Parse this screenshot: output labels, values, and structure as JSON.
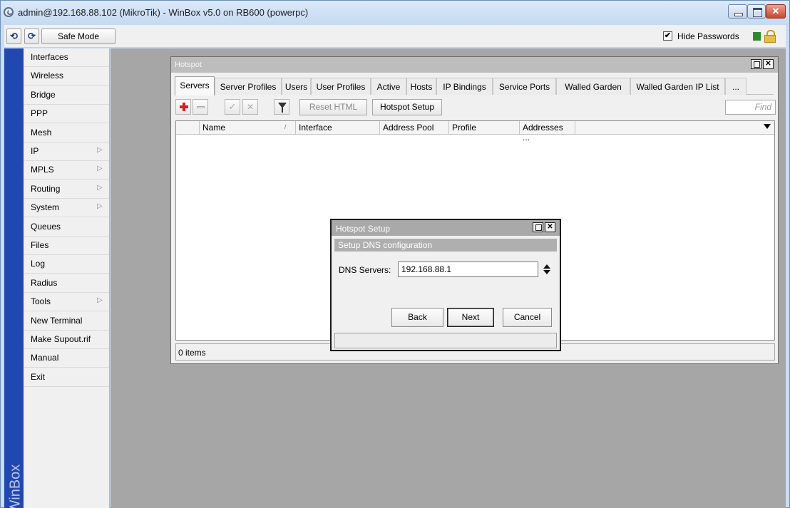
{
  "window": {
    "title": "admin@192.168.88.102 (MikroTik) - WinBox v5.0 on RB600 (powerpc)"
  },
  "toolbar": {
    "undo_icon": "undo-icon",
    "redo_icon": "redo-icon",
    "safe_mode_label": "Safe Mode",
    "hide_passwords_label": "Hide Passwords",
    "hide_passwords_checked": true,
    "hide_passwords_mark": "✔"
  },
  "brand": {
    "vertical_text": "S WinBox"
  },
  "sidebar": {
    "items": [
      {
        "label": "Interfaces",
        "submenu": false
      },
      {
        "label": "Wireless",
        "submenu": false
      },
      {
        "label": "Bridge",
        "submenu": false
      },
      {
        "label": "PPP",
        "submenu": false
      },
      {
        "label": "Mesh",
        "submenu": false
      },
      {
        "label": "IP",
        "submenu": true
      },
      {
        "label": "MPLS",
        "submenu": true
      },
      {
        "label": "Routing",
        "submenu": true
      },
      {
        "label": "System",
        "submenu": true
      },
      {
        "label": "Queues",
        "submenu": false
      },
      {
        "label": "Files",
        "submenu": false
      },
      {
        "label": "Log",
        "submenu": false
      },
      {
        "label": "Radius",
        "submenu": false
      },
      {
        "label": "Tools",
        "submenu": true
      },
      {
        "label": "New Terminal",
        "submenu": false
      },
      {
        "label": "Make Supout.rif",
        "submenu": false
      },
      {
        "label": "Manual",
        "submenu": false
      },
      {
        "label": "Exit",
        "submenu": false
      }
    ],
    "submenu_arrow": "▷"
  },
  "hotspot": {
    "title": "Hotspot",
    "tabs": [
      {
        "label": "Servers",
        "active": true
      },
      {
        "label": "Server Profiles",
        "active": false
      },
      {
        "label": "Users",
        "active": false
      },
      {
        "label": "User Profiles",
        "active": false
      },
      {
        "label": "Active",
        "active": false
      },
      {
        "label": "Hosts",
        "active": false
      },
      {
        "label": "IP Bindings",
        "active": false
      },
      {
        "label": "Service Ports",
        "active": false
      },
      {
        "label": "Walled Garden",
        "active": false
      },
      {
        "label": "Walled Garden IP List",
        "active": false
      },
      {
        "label": "...",
        "active": false
      }
    ],
    "buttons": {
      "reset_html": "Reset HTML",
      "hotspot_setup": "Hotspot Setup"
    },
    "find_placeholder": "Find",
    "columns": [
      "Name",
      "Interface",
      "Address Pool",
      "Profile",
      "Addresses ..."
    ],
    "sort_indicator": "/",
    "status": "0 items"
  },
  "setup_dialog": {
    "title": "Hotspot Setup",
    "section": "Setup DNS configuration",
    "dns_label": "DNS Servers:",
    "dns_value": "192.168.88.1",
    "back_label": "Back",
    "next_label": "Next",
    "cancel_label": "Cancel"
  },
  "colors": {
    "brand_strip": "#2147b0",
    "add_icon": "#d3201f",
    "status_green": "#2f8a2f",
    "lock": "#e8be3a"
  }
}
